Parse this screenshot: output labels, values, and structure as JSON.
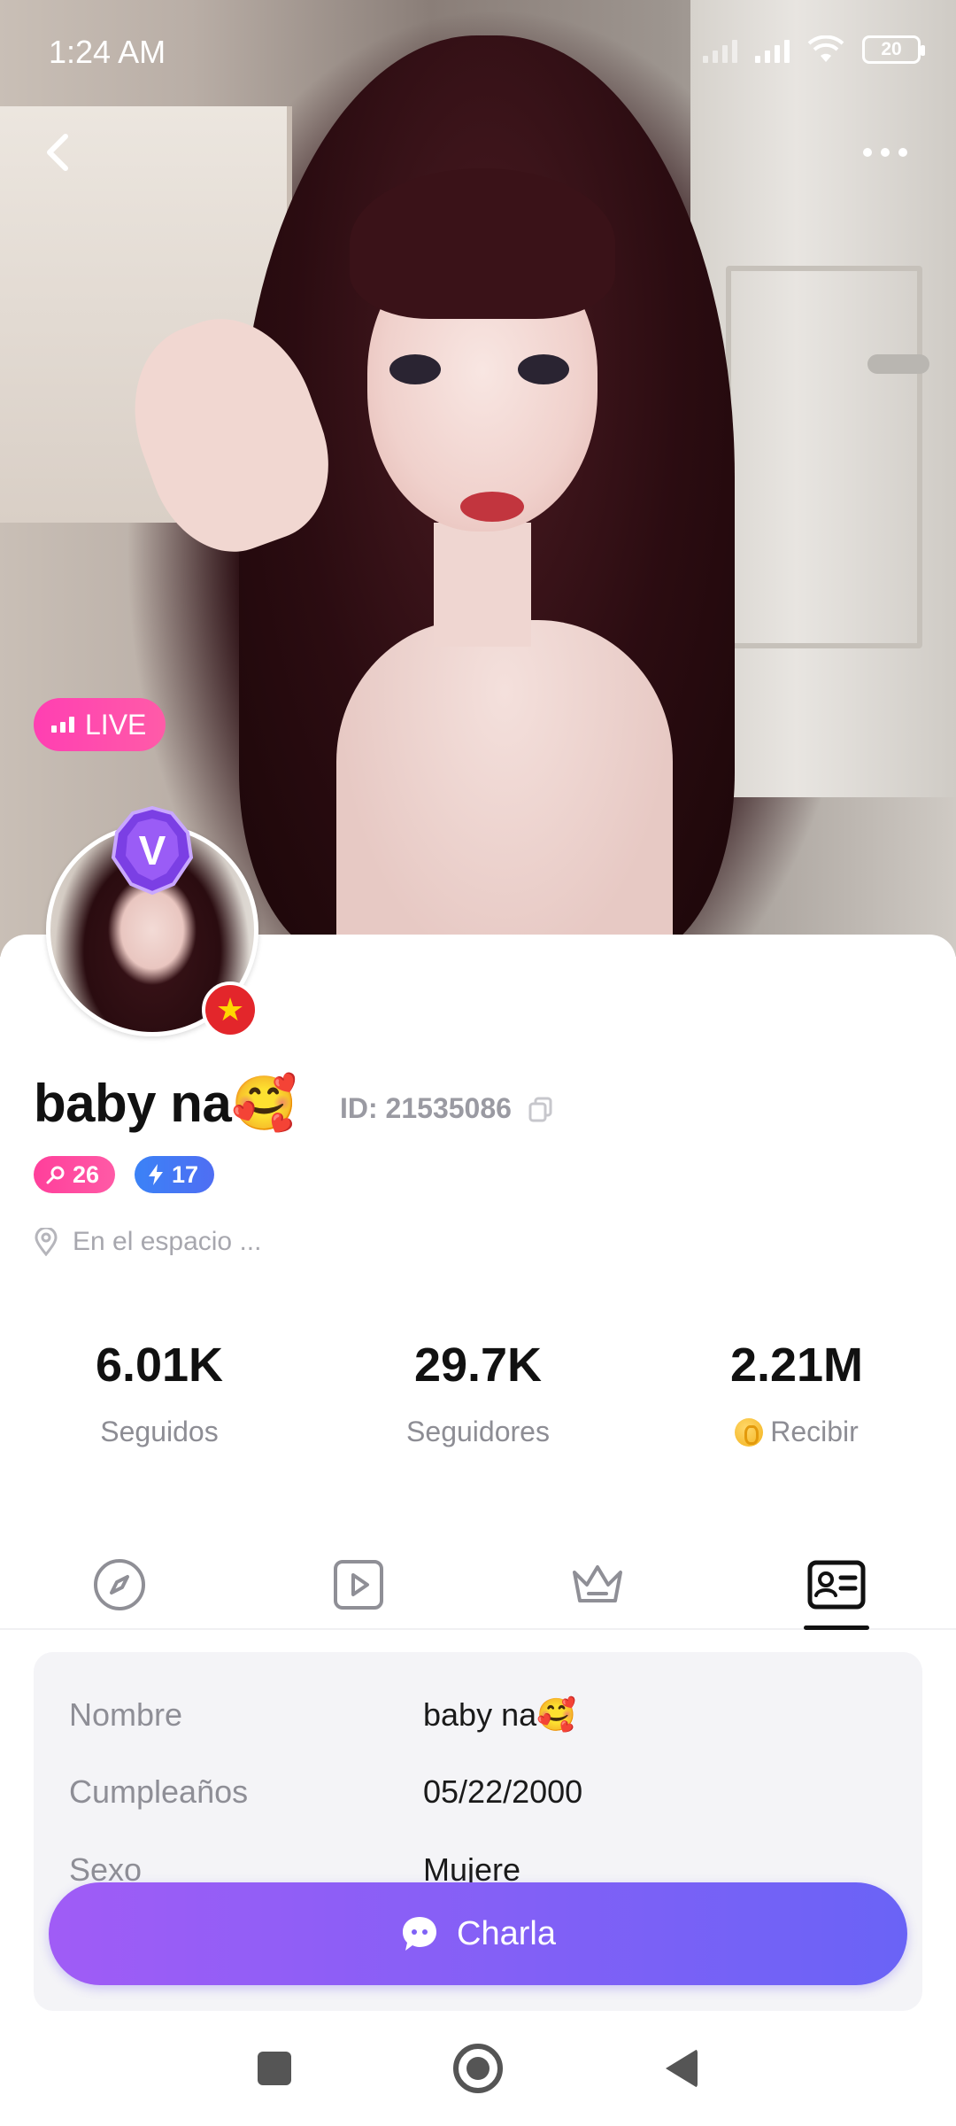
{
  "status_bar": {
    "time": "1:24 AM",
    "battery": "20",
    "icons": [
      "signal-weak-icon",
      "signal-icon",
      "wifi-icon",
      "battery-icon"
    ]
  },
  "header": {
    "back_icon": "chevron-left-icon",
    "more_icon": "more-horizontal-icon"
  },
  "live_badge": {
    "label": "LIVE",
    "icon": "live-bars-icon",
    "color": "#ff3fb2"
  },
  "profile": {
    "name": "baby na🥰",
    "id_text": "ID: 21535086",
    "vip_badge": "V",
    "country_flag": "★",
    "levels": [
      {
        "icon": "charm-icon",
        "value": "26",
        "color": "#ff3f9b"
      },
      {
        "icon": "lightning-icon",
        "value": "17",
        "color": "#3b82f6"
      }
    ],
    "location": "En el espacio ..."
  },
  "stats": [
    {
      "value": "6.01K",
      "label": "Seguidos"
    },
    {
      "value": "29.7K",
      "label": "Seguidores"
    },
    {
      "value": "2.21M",
      "label": "Recibir",
      "icon": "coin-icon"
    }
  ],
  "tabs": [
    {
      "icon": "compass-icon",
      "active": false
    },
    {
      "icon": "video-play-icon",
      "active": false
    },
    {
      "icon": "crown-icon",
      "active": false
    },
    {
      "icon": "id-card-icon",
      "active": true
    }
  ],
  "info": {
    "rows": [
      {
        "label": "Nombre",
        "value": "baby na🥰"
      },
      {
        "label": "Cumpleaños",
        "value": "05/22/2000"
      },
      {
        "label": "Sexo",
        "value": "Mujere"
      }
    ]
  },
  "chat_button": {
    "label": "Charla",
    "icon": "chat-bubble-icon",
    "color_from": "#a05cf6",
    "color_to": "#6a63f6"
  },
  "nav_bar": {
    "icons": [
      "recents-square-icon",
      "home-circle-icon",
      "back-triangle-icon"
    ]
  }
}
